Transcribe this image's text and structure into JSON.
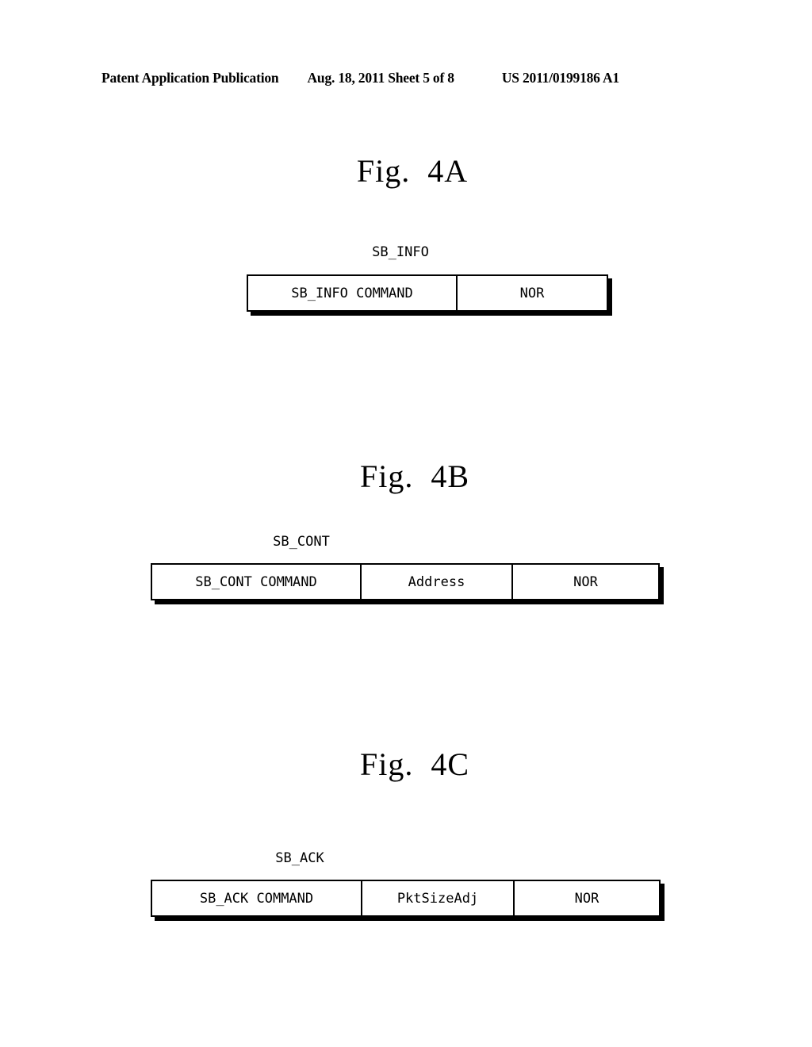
{
  "header": {
    "publication": "Patent Application Publication",
    "date_sheet": "Aug. 18, 2011  Sheet 5 of 8",
    "patent_number": "US 2011/0199186 A1"
  },
  "figures": [
    {
      "id": "4A",
      "title_word": "Fig.",
      "title_number": "4A",
      "packet_label": "SB_INFO",
      "fields": [
        {
          "name": "SB_INFO COMMAND"
        },
        {
          "name": "NOR"
        }
      ]
    },
    {
      "id": "4B",
      "title_word": "Fig.",
      "title_number": "4B",
      "packet_label": "SB_CONT",
      "fields": [
        {
          "name": "SB_CONT COMMAND"
        },
        {
          "name": "Address"
        },
        {
          "name": "NOR"
        }
      ]
    },
    {
      "id": "4C",
      "title_word": "Fig.",
      "title_number": "4C",
      "packet_label": "SB_ACK",
      "fields": [
        {
          "name": "SB_ACK COMMAND"
        },
        {
          "name": "PktSizeAdj"
        },
        {
          "name": "NOR"
        }
      ]
    }
  ],
  "colors": {
    "ink": "#000000",
    "paper": "#ffffff"
  }
}
